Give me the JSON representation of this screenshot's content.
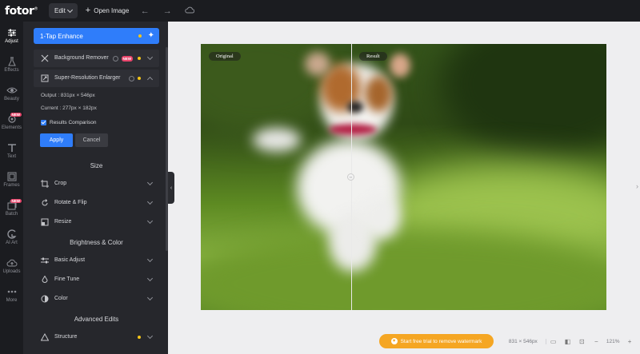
{
  "app": {
    "logo": "fotor",
    "logo_mark": "®"
  },
  "topbar": {
    "edit_label": "Edit",
    "open_image_label": "Open Image",
    "undo_icon": "undo-icon",
    "redo_icon": "redo-icon",
    "cloud_icon": "cloud-icon"
  },
  "rail": {
    "items": [
      {
        "label": "Adjust",
        "icon": "sliders-icon",
        "active": true
      },
      {
        "label": "Effects",
        "icon": "flask-icon"
      },
      {
        "label": "Beauty",
        "icon": "eye-icon"
      },
      {
        "label": "Elements",
        "icon": "shapes-icon",
        "badge": "NEW"
      },
      {
        "label": "Text",
        "icon": "text-icon"
      },
      {
        "label": "Frames",
        "icon": "frame-icon"
      },
      {
        "label": "Batch",
        "icon": "batch-icon",
        "badge": "NEW"
      },
      {
        "label": "AI Art",
        "icon": "ai-art-icon"
      },
      {
        "label": "Uploads",
        "icon": "upload-icon"
      },
      {
        "label": "More",
        "icon": "more-icon"
      }
    ]
  },
  "panel": {
    "enhance_label": "1-Tap Enhance",
    "bg_remover_label": "Background Remover",
    "bg_remover_badge": "NEW",
    "sre_label": "Super-Resolution Enlarger",
    "output_text": "Output : 831px × 546px",
    "current_text": "Current : 277px × 182px",
    "results_comparison": "Results Comparison",
    "apply_label": "Apply",
    "cancel_label": "Cancel",
    "size_section": "Size",
    "crop_label": "Crop",
    "rotate_label": "Rotate & Flip",
    "resize_label": "Resize",
    "brightness_section": "Brightness & Color",
    "basic_adjust_label": "Basic Adjust",
    "fine_tune_label": "Fine Tune",
    "color_label": "Color",
    "advanced_section": "Advanced Edits",
    "structure_label": "Structure"
  },
  "canvas": {
    "original_tag": "Original",
    "result_tag": "Result",
    "comparison_position": 0.37
  },
  "bottom": {
    "watermark_label": "Start free trial to remove watermark",
    "size_text": "831 × 546px",
    "zoom_text": "121%",
    "zoom_out": "−",
    "zoom_in": "+"
  },
  "colors": {
    "accent": "#2f7dfa",
    "badge": "#e8456b",
    "premium_dot": "#f5c518",
    "watermark": "#f5a623"
  }
}
